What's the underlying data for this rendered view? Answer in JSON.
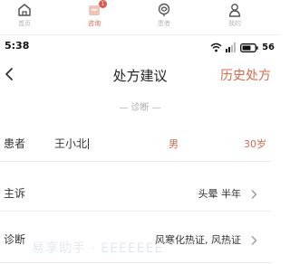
{
  "tabbar": {
    "tabs": [
      {
        "label": "首页",
        "icon": "home-icon",
        "active": false
      },
      {
        "label": "咨询",
        "icon": "consult-icon",
        "active": true,
        "badge": "1"
      },
      {
        "label": "患者",
        "icon": "patient-icon",
        "active": false
      },
      {
        "label": "我的",
        "icon": "profile-icon",
        "active": false
      }
    ]
  },
  "status_bar": {
    "time": "5:38",
    "battery": "56"
  },
  "nav": {
    "title": "处方建议",
    "history_link": "历史处方"
  },
  "diagnosis_section": {
    "header": "— 诊断 —",
    "patient": {
      "label": "患者",
      "name": "王小北",
      "gender": "男",
      "age": "30岁"
    },
    "chief_complaint": {
      "label": "主诉",
      "value": "头晕 半年"
    },
    "diagnosis": {
      "label": "诊断",
      "value": "风寒化热证, 风热证"
    }
  },
  "watermark": "易享助手 · EEEEEEE",
  "colors": {
    "accent": "#d9674b",
    "muted": "#b5b5b5",
    "badge": "#e2574c"
  }
}
